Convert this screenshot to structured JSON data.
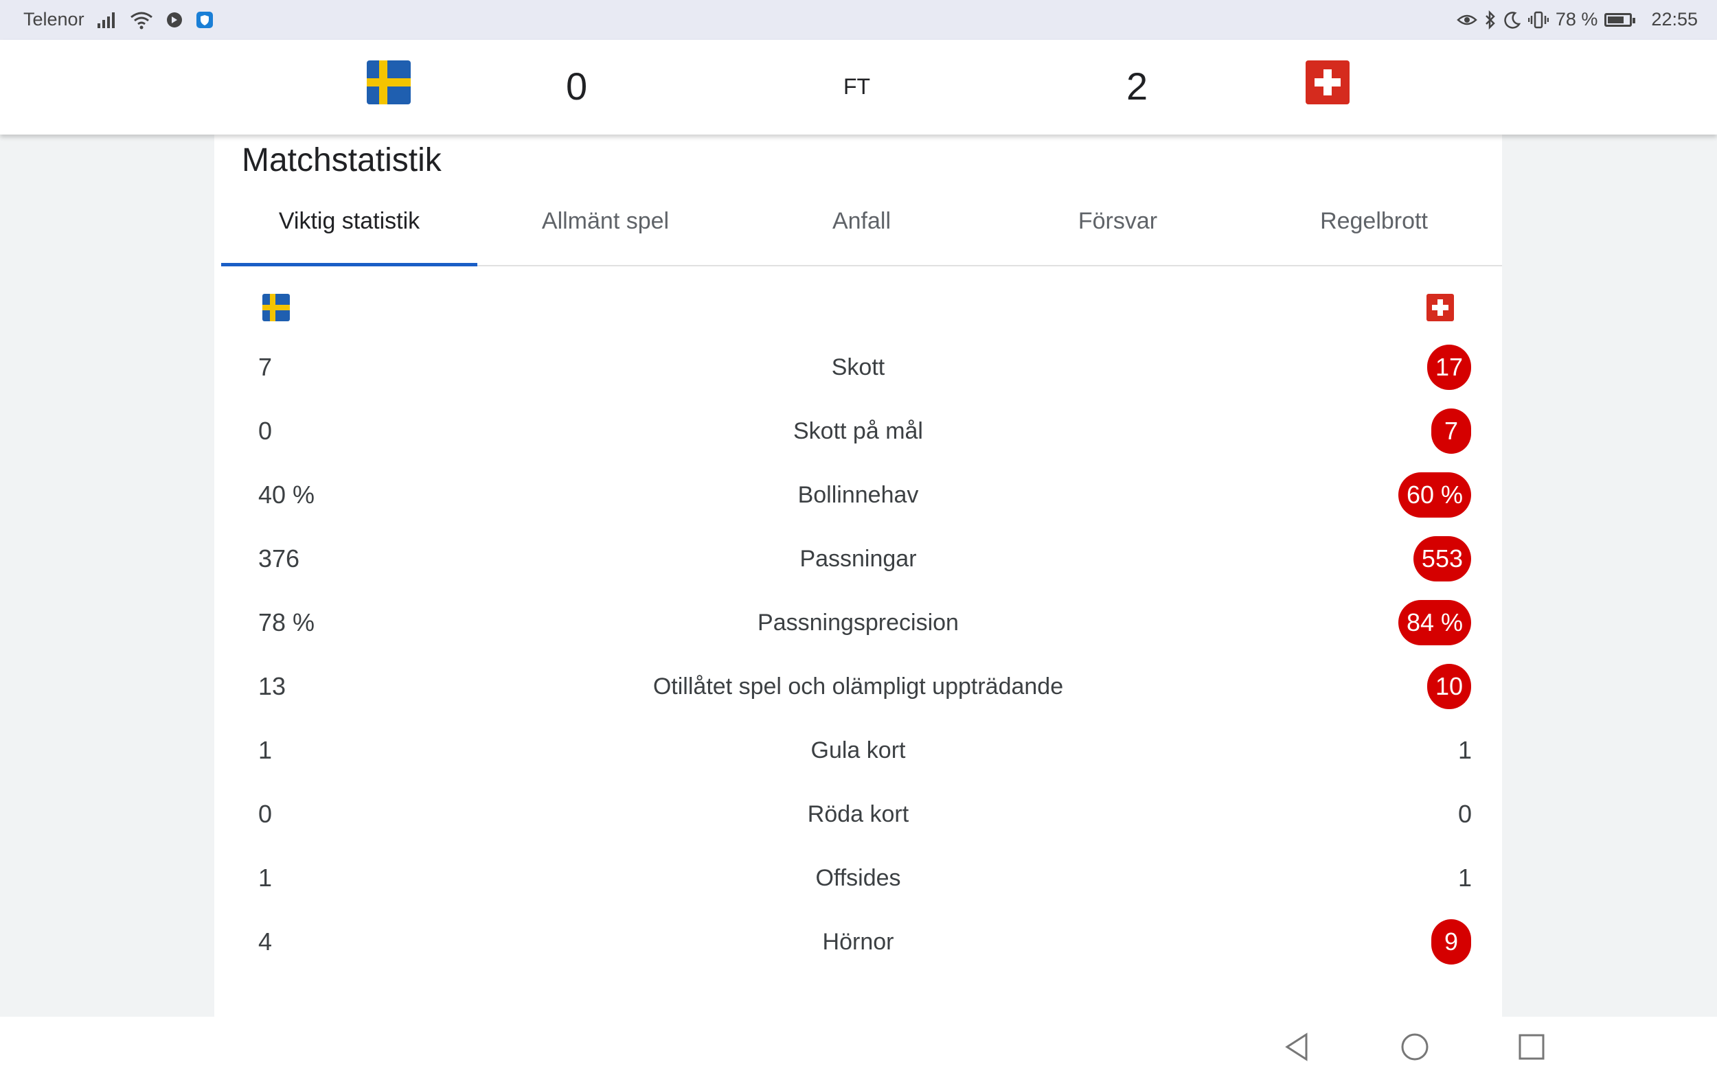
{
  "status_bar": {
    "carrier": "Telenor",
    "battery_text": "78 %",
    "battery_level": 0.78,
    "time": "22:55",
    "left_icons": [
      "signal-icon",
      "wifi-icon",
      "cast-icon",
      "app-shield-icon"
    ],
    "right_icons": [
      "eye-icon",
      "bluetooth-icon",
      "moon-icon",
      "vibrate-icon",
      "battery-icon"
    ]
  },
  "match": {
    "home_flag": "sweden-flag-icon",
    "away_flag": "switzerland-flag-icon",
    "home_score": "0",
    "status": "FT",
    "away_score": "2"
  },
  "section_title": "Matchstatistik",
  "tabs": [
    {
      "label": "Viktig statistik",
      "active": true
    },
    {
      "label": "Allmänt spel",
      "active": false
    },
    {
      "label": "Anfall",
      "active": false
    },
    {
      "label": "Försvar",
      "active": false
    },
    {
      "label": "Regelbrott",
      "active": false
    }
  ],
  "stats": [
    {
      "label": "Skott",
      "home": "7",
      "away": "17",
      "away_highlight": true
    },
    {
      "label": "Skott på mål",
      "home": "0",
      "away": "7",
      "away_highlight": true
    },
    {
      "label": "Bollinnehav",
      "home": "40 %",
      "away": "60 %",
      "away_highlight": true
    },
    {
      "label": "Passningar",
      "home": "376",
      "away": "553",
      "away_highlight": true
    },
    {
      "label": "Passningsprecision",
      "home": "78 %",
      "away": "84 %",
      "away_highlight": true
    },
    {
      "label": "Otillåtet spel och olämpligt uppträdande",
      "home": "13",
      "away": "10",
      "away_highlight": true
    },
    {
      "label": "Gula kort",
      "home": "1",
      "away": "1",
      "away_highlight": false
    },
    {
      "label": "Röda kort",
      "home": "0",
      "away": "0",
      "away_highlight": false
    },
    {
      "label": "Offsides",
      "home": "1",
      "away": "1",
      "away_highlight": false
    },
    {
      "label": "Hörnor",
      "home": "4",
      "away": "9",
      "away_highlight": true
    }
  ],
  "colors": {
    "highlight": "#d50000",
    "tab_indicator": "#1a5ec6",
    "sweden_blue": "#1f5fb0",
    "sweden_yellow": "#f4c400",
    "swiss_red": "#d52b1e"
  },
  "nav": [
    "back-icon",
    "home-icon",
    "recents-icon"
  ]
}
